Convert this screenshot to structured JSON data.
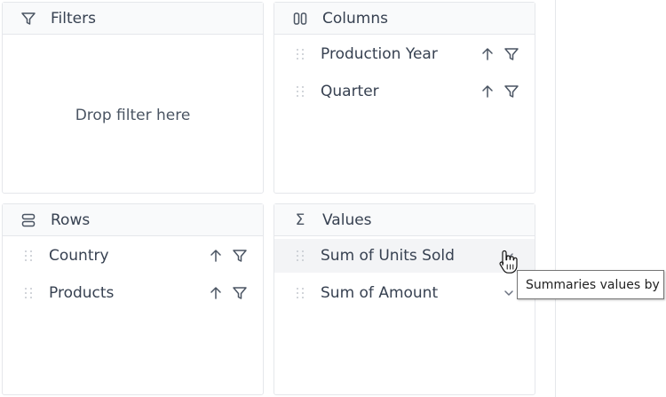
{
  "filters": {
    "title": "Filters",
    "icon": "filter-icon",
    "empty_text": "Drop filter here"
  },
  "columns": {
    "title": "Columns",
    "icon": "columns-icon",
    "items": [
      {
        "label": "Production Year"
      },
      {
        "label": "Quarter"
      }
    ]
  },
  "rows": {
    "title": "Rows",
    "icon": "rows-icon",
    "items": [
      {
        "label": "Country"
      },
      {
        "label": "Products"
      }
    ]
  },
  "values": {
    "title": "Values",
    "icon": "sigma-icon",
    "sigma": "Σ",
    "items": [
      {
        "label": "Sum of Units Sold",
        "hovered": true
      },
      {
        "label": "Sum of Amount"
      }
    ]
  },
  "tooltip": {
    "text": "Summaries values by"
  },
  "colors": {
    "panel_border": "#e5e7eb",
    "header_bg": "#f9fafb",
    "hover_bg": "#f3f4f6",
    "text": "#374151"
  }
}
